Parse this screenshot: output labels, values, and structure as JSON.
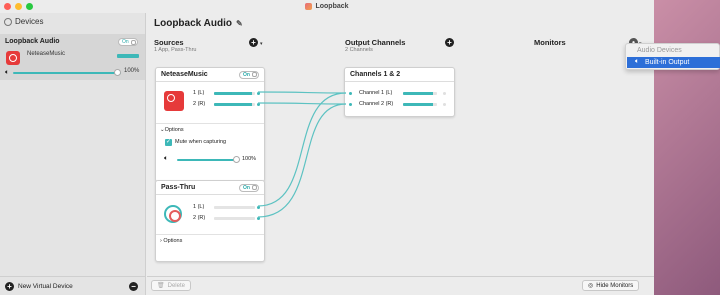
{
  "window": {
    "title": "Loopback"
  },
  "sidebar": {
    "header": "Devices",
    "device": {
      "name": "Loopback Audio",
      "toggle": "On",
      "app_label": "NeteaseMusic",
      "volume_pct": "100%",
      "volume_level": 1.0
    },
    "new_device_label": "New Virtual Device"
  },
  "main": {
    "device_title": "Loopback Audio",
    "sources": {
      "title": "Sources",
      "subtitle": "1 App, Pass-Thru"
    },
    "output_channels": {
      "title": "Output Channels",
      "subtitle": "2 Channels"
    },
    "monitors": {
      "title": "Monitors"
    }
  },
  "netease_card": {
    "title": "NeteaseMusic",
    "toggle": "On",
    "channels": [
      {
        "label": "1 (L)",
        "level": 0.92
      },
      {
        "label": "2 (R)",
        "level": 0.92
      }
    ],
    "options_label": "Options",
    "mute_label": "Mute when capturing",
    "mute_checked": true,
    "volume_pct": "100%",
    "volume_level": 1.0
  },
  "passthru_card": {
    "title": "Pass-Thru",
    "toggle": "On",
    "channels": [
      {
        "label": "1 (L)",
        "level": 0.0
      },
      {
        "label": "2 (R)",
        "level": 0.0
      }
    ],
    "options_label": "Options"
  },
  "output_card": {
    "title": "Channels 1 & 2",
    "channels": [
      {
        "label": "Channel 1 (L)",
        "level": 0.88
      },
      {
        "label": "Channel 2 (R)",
        "level": 0.88
      }
    ]
  },
  "bottom": {
    "delete_label": "Delete",
    "hide_monitors_label": "Hide Monitors"
  },
  "dropdown": {
    "header": "Audio Devices",
    "selected": "Built-in Output"
  },
  "colors": {
    "accent": "#3db8b8",
    "selection": "#2d6fd8"
  }
}
